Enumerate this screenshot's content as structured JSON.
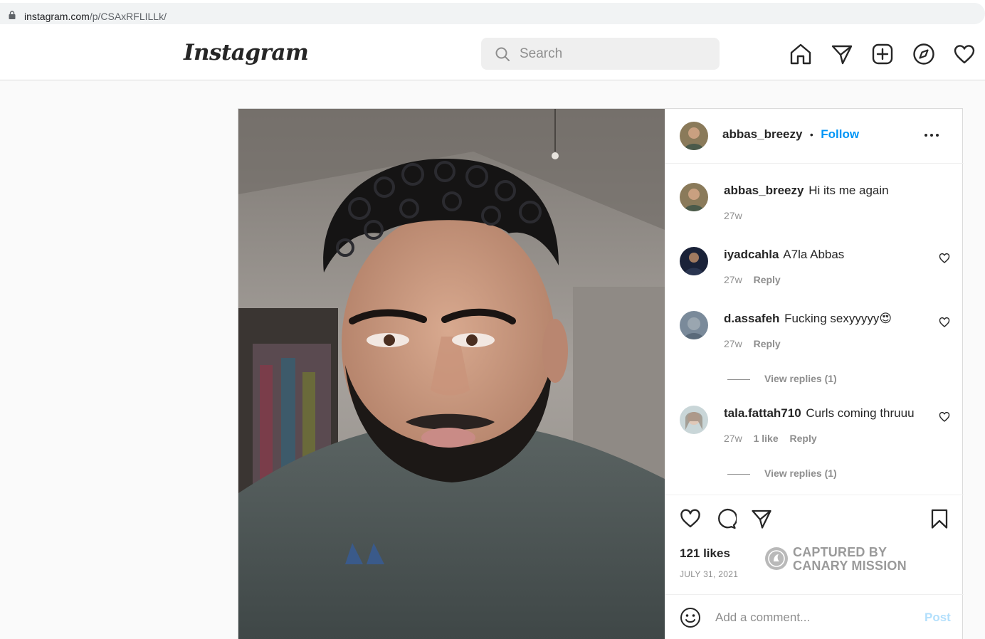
{
  "browser": {
    "domain": "instagram.com",
    "path": "/p/CSAxRFLILLk/"
  },
  "header": {
    "logo_text": "Instagram",
    "search_placeholder": "Search",
    "nav_icons": [
      "home-icon",
      "direct-message-icon",
      "new-post-icon",
      "explore-icon",
      "activity-heart-icon"
    ]
  },
  "post": {
    "author": "abbas_breezy",
    "separator": "•",
    "follow_label": "Follow",
    "caption": {
      "username": "abbas_breezy",
      "text": "Hi its me again",
      "age": "27w"
    },
    "comments": [
      {
        "username": "iyadcahla",
        "text": "A7la Abbas",
        "age": "27w",
        "likes": "",
        "reply_label": "Reply",
        "view_replies": ""
      },
      {
        "username": "d.assafeh",
        "text": "Fucking sexyyyyy",
        "emoji": "😍",
        "age": "27w",
        "likes": "",
        "reply_label": "Reply",
        "view_replies": "View replies (1)"
      },
      {
        "username": "tala.fattah710",
        "text": "Curls coming thruuu",
        "age": "27w",
        "likes": "1 like",
        "reply_label": "Reply",
        "view_replies": "View replies (1)"
      }
    ],
    "likes": "121 likes",
    "date": "JULY 31, 2021",
    "watermark": [
      "CAPTURED BY",
      "CANARY MISSION"
    ],
    "add_comment_placeholder": "Add a comment...",
    "post_label": "Post"
  },
  "colors": {
    "link_blue": "#0095f6",
    "post_disabled": "#b2dffc",
    "muted": "#8e8e8e",
    "border": "#dbdbdb"
  }
}
